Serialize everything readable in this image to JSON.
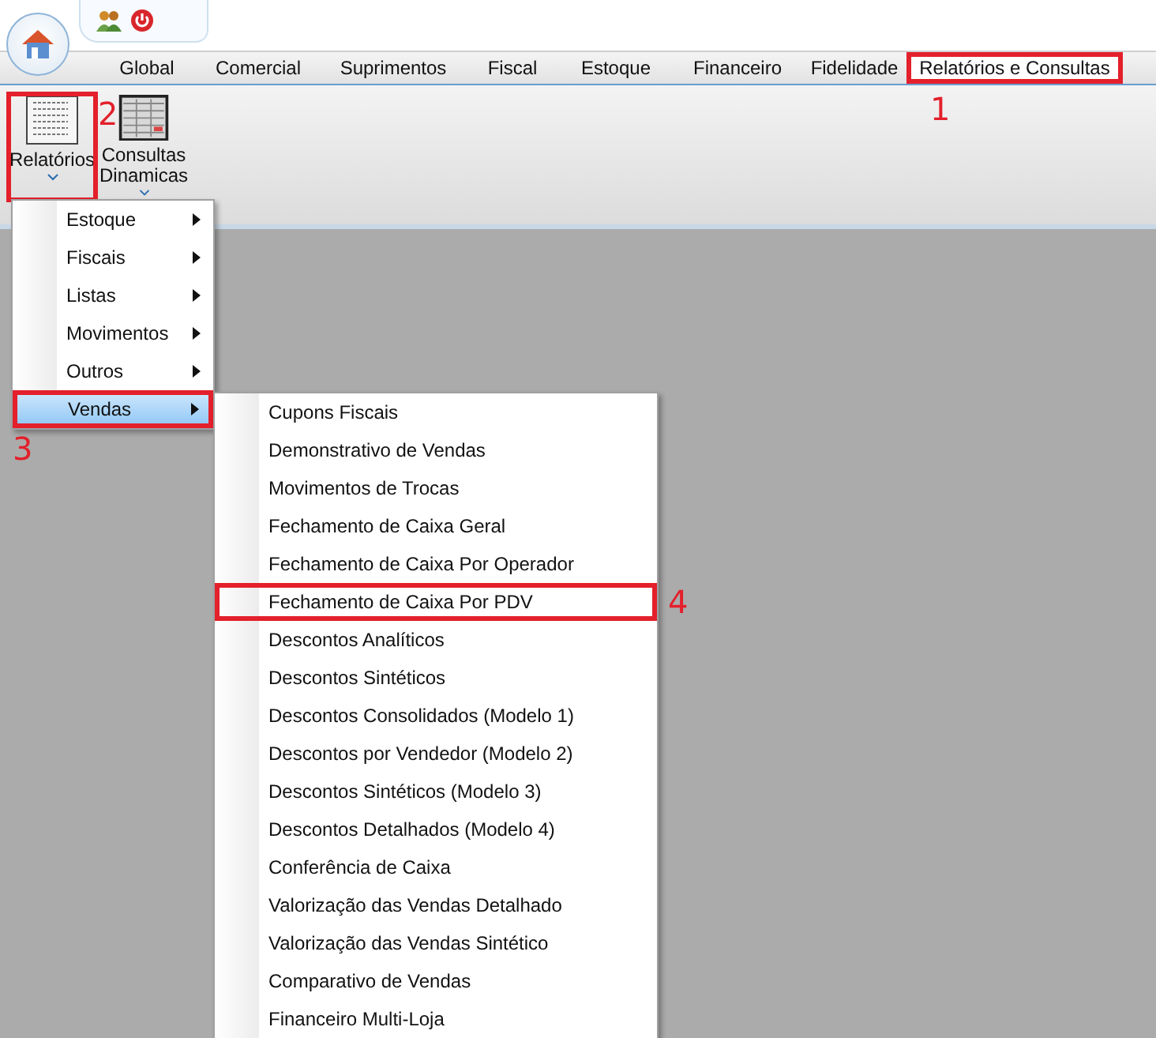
{
  "quick_access": {
    "buttons": [
      {
        "kind": "users"
      },
      {
        "kind": "power"
      }
    ]
  },
  "tabs": [
    {
      "label": "Global",
      "selected": false
    },
    {
      "label": "Comercial",
      "selected": false
    },
    {
      "label": "Suprimentos",
      "selected": false
    },
    {
      "label": "Fiscal",
      "selected": false
    },
    {
      "label": "Estoque",
      "selected": false
    },
    {
      "label": "Financeiro",
      "selected": false
    },
    {
      "label": "Fidelidade",
      "selected": false
    },
    {
      "label": "Relatórios e Consultas",
      "selected": true,
      "callout": "1"
    }
  ],
  "ribbon": {
    "buttons": [
      {
        "label": "Relatórios",
        "kind": "report",
        "callout": "2"
      },
      {
        "label": "Consultas Dinamicas",
        "kind": "grid"
      }
    ]
  },
  "menu": {
    "items": [
      {
        "label": "Estoque",
        "selected": false
      },
      {
        "label": "Fiscais",
        "selected": false
      },
      {
        "label": "Listas",
        "selected": false
      },
      {
        "label": "Movimentos",
        "selected": false
      },
      {
        "label": "Outros",
        "selected": false
      },
      {
        "label": "Vendas",
        "selected": true,
        "callout": "3"
      }
    ]
  },
  "submenu": {
    "items": [
      {
        "label": "Cupons Fiscais"
      },
      {
        "label": "Demonstrativo de Vendas"
      },
      {
        "label": "Movimentos de Trocas"
      },
      {
        "label": "Fechamento de Caixa Geral"
      },
      {
        "label": "Fechamento de Caixa Por Operador"
      },
      {
        "label": "Fechamento de Caixa Por PDV",
        "callout": "4"
      },
      {
        "label": "Descontos Analíticos"
      },
      {
        "label": "Descontos Sintéticos"
      },
      {
        "label": "Descontos Consolidados (Modelo 1)"
      },
      {
        "label": "Descontos por Vendedor (Modelo 2)"
      },
      {
        "label": "Descontos Sintéticos (Modelo 3)"
      },
      {
        "label": "Descontos Detalhados (Modelo 4)"
      },
      {
        "label": "Conferência de Caixa"
      },
      {
        "label": "Valorização das Vendas Detalhado"
      },
      {
        "label": "Valorização das Vendas Sintético"
      },
      {
        "label": "Comparativo de Vendas"
      },
      {
        "label": "Financeiro Multi-Loja"
      }
    ]
  }
}
